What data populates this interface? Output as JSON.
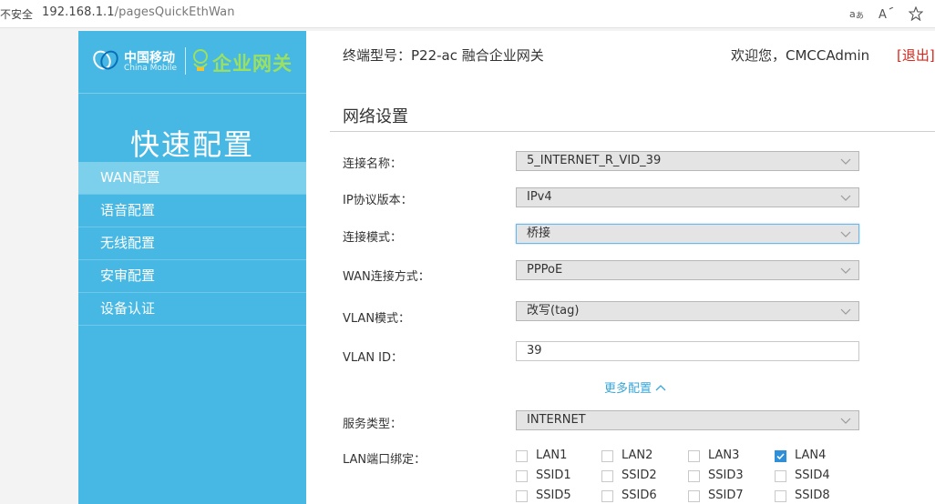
{
  "browser": {
    "insecure_label": "不安全",
    "url_host": "192.168.1.1",
    "url_path": "/pagesQuickEthWan",
    "icons": [
      "read-aloud-icon",
      "text-size-icon",
      "favorite-star-icon"
    ]
  },
  "sidebar": {
    "brand_cn": "中国移动",
    "brand_en": "China Mobile",
    "product": "企业网关",
    "title": "快速配置",
    "items": [
      {
        "label": "WAN配置",
        "active": true
      },
      {
        "label": "语音配置",
        "active": false
      },
      {
        "label": "无线配置",
        "active": false
      },
      {
        "label": "安审配置",
        "active": false
      },
      {
        "label": "设备认证",
        "active": false
      }
    ]
  },
  "header": {
    "model": "终端型号：P22-ac 融合企业网关",
    "welcome": "欢迎您，CMCCAdmin",
    "logout": "[退出]"
  },
  "section": {
    "title": "网络设置"
  },
  "form": {
    "connection_name_label": "连接名称：",
    "connection_name_value": "5_INTERNET_R_VID_39",
    "ip_version_label": "IP协议版本：",
    "ip_version_value": "IPv4",
    "connection_mode_label": "连接模式：",
    "connection_mode_value": "桥接",
    "wan_type_label": "WAN连接方式：",
    "wan_type_value": "PPPoE",
    "vlan_mode_label": "VLAN模式：",
    "vlan_mode_value": "改写(tag)",
    "vlan_id_label": "VLAN ID：",
    "vlan_id_value": "39",
    "more_config": "更多配置",
    "service_type_label": "服务类型：",
    "service_type_value": "INTERNET",
    "lan_binding_label": "LAN端口绑定：",
    "ports": [
      {
        "label": "LAN1",
        "checked": false
      },
      {
        "label": "LAN2",
        "checked": false
      },
      {
        "label": "LAN3",
        "checked": false
      },
      {
        "label": "LAN4",
        "checked": true
      },
      {
        "label": "SSID1",
        "checked": false
      },
      {
        "label": "SSID2",
        "checked": false
      },
      {
        "label": "SSID3",
        "checked": false
      },
      {
        "label": "SSID4",
        "checked": false
      },
      {
        "label": "SSID5",
        "checked": false
      },
      {
        "label": "SSID6",
        "checked": false
      },
      {
        "label": "SSID7",
        "checked": false
      },
      {
        "label": "SSID8",
        "checked": false
      }
    ]
  },
  "colors": {
    "sidebar_bg": "#46b8e3",
    "sidebar_active": "#7dd0ec",
    "logout": "#d9251c",
    "link": "#3aa6d8",
    "checkbox_checked": "#2f8fd8"
  }
}
